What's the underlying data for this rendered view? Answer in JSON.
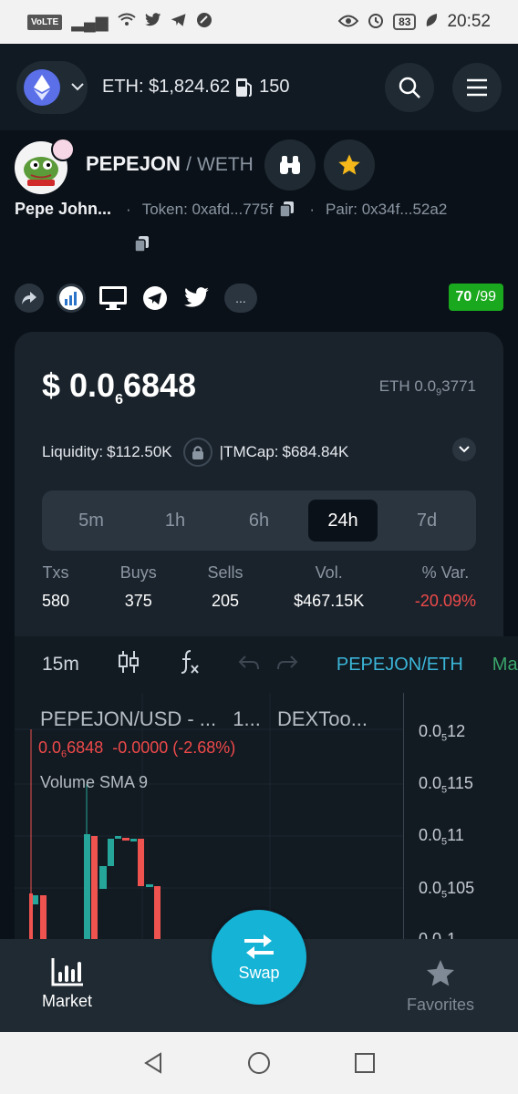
{
  "status_bar": {
    "volte": "VoLTE",
    "battery": "83",
    "time": "20:52"
  },
  "header": {
    "eth_price": "ETH: $1,824.62",
    "gas": "150"
  },
  "token": {
    "symbol": "PEPEJON",
    "separator": "/",
    "quote": "WETH",
    "name": "Pepe John...",
    "token_label": "Token: 0xafd...775f",
    "pair_label": "Pair: 0x34f...52a2",
    "more": "...",
    "score": "70",
    "score_max": "/99"
  },
  "price": {
    "usd_prefix": "$ 0.0",
    "usd_zeros": "6",
    "usd_digits": "6848",
    "eth_prefix": "ETH 0.0",
    "eth_zeros": "9",
    "eth_digits": "3771",
    "liquidity_label": "Liquidity:",
    "liquidity_value": "$112.50K",
    "tmcap_label": "|TMCap:",
    "tmcap_value": "$684.84K"
  },
  "timeframes": [
    "5m",
    "1h",
    "6h",
    "24h",
    "7d"
  ],
  "active_timeframe": "24h",
  "stats": [
    {
      "label": "Txs",
      "value": "580"
    },
    {
      "label": "Buys",
      "value": "375"
    },
    {
      "label": "Sells",
      "value": "205"
    },
    {
      "label": "Vol.",
      "value": "$467.15K"
    },
    {
      "label": "% Var.",
      "value": "-20.09%"
    }
  ],
  "chart_toolbar": {
    "interval": "15m",
    "pair": "PEPEJON/ETH",
    "more": "Ma"
  },
  "chart": {
    "legend_symbol": "PEPEJON/USD - ...",
    "legend_interval": "1...",
    "legend_source": "DEXToo...",
    "price_prefix": "0.0",
    "price_zeros": "6",
    "price_digits": "6848",
    "price_change": "-0.0000 (-2.68%)",
    "volume_label": "Volume SMA 9",
    "axis_labels": [
      {
        "prefix": "0.0",
        "zeros": "5",
        "digits": "12"
      },
      {
        "prefix": "0.0",
        "zeros": "5",
        "digits": "115"
      },
      {
        "prefix": "0.0",
        "zeros": "5",
        "digits": "11"
      },
      {
        "prefix": "0.0",
        "zeros": "5",
        "digits": "105"
      },
      {
        "prefix": "0.0",
        "zeros": "5",
        "digits": "1"
      }
    ]
  },
  "bottom_nav": {
    "market": "Market",
    "swap": "Swap",
    "favorites": "Favorites"
  },
  "colors": {
    "accent": "#15b3d6",
    "negative": "#ef4a4a",
    "positive": "#19a81e",
    "candle_up": "#26a69a",
    "candle_down": "#ef5350"
  }
}
